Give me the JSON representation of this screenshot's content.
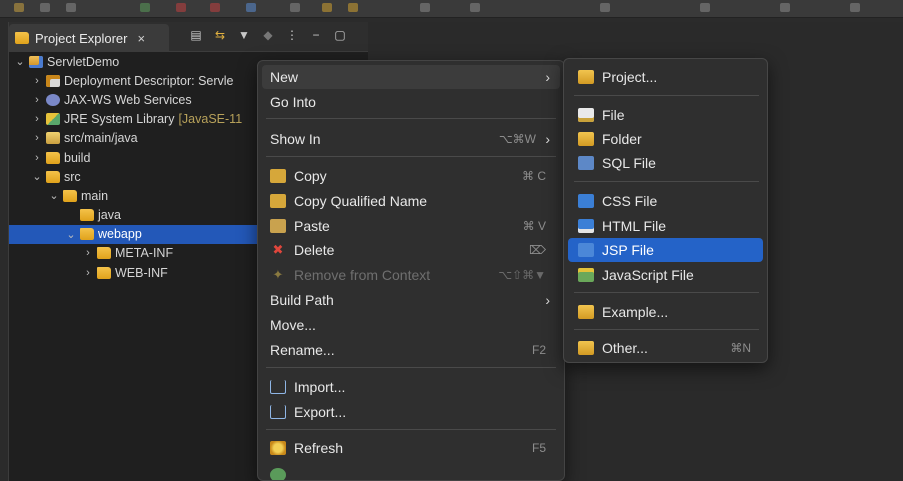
{
  "explorer": {
    "tab_title": "Project Explorer",
    "tab_close": "×",
    "tree": [
      {
        "indent": 0,
        "chev": "⌄",
        "icon": "project",
        "label": "ServletDemo"
      },
      {
        "indent": 1,
        "chev": "›",
        "icon": "descriptor",
        "label": "Deployment Descriptor: Servle"
      },
      {
        "indent": 1,
        "chev": "›",
        "icon": "webservices",
        "label": "JAX-WS Web Services"
      },
      {
        "indent": 1,
        "chev": "›",
        "icon": "library",
        "label": "JRE System Library",
        "extra": "[JavaSE-11"
      },
      {
        "indent": 1,
        "chev": "›",
        "icon": "package",
        "label": "src/main/java"
      },
      {
        "indent": 1,
        "chev": "›",
        "icon": "folder",
        "label": "build"
      },
      {
        "indent": 1,
        "chev": "⌄",
        "icon": "folder",
        "label": "src"
      },
      {
        "indent": 2,
        "chev": "⌄",
        "icon": "folder",
        "label": "main"
      },
      {
        "indent": 3,
        "chev": "",
        "icon": "folder",
        "label": "java"
      },
      {
        "indent": 3,
        "chev": "⌄",
        "icon": "folder",
        "label": "webapp",
        "selected": true
      },
      {
        "indent": 4,
        "chev": "›",
        "icon": "folder",
        "label": "META-INF"
      },
      {
        "indent": 4,
        "chev": "›",
        "icon": "folder",
        "label": "WEB-INF"
      }
    ]
  },
  "context_menu": {
    "new": "New",
    "go_into": "Go Into",
    "show_in": "Show In",
    "show_in_sc": "⌥⌘W",
    "copy": "Copy",
    "copy_sc": "⌘ C",
    "copy_qualified": "Copy Qualified Name",
    "paste": "Paste",
    "paste_sc": "⌘ V",
    "delete": "Delete",
    "delete_sc": "⌦",
    "remove_context": "Remove from Context",
    "remove_context_sc": "⌥⇧⌘▼",
    "build_path": "Build Path",
    "move": "Move...",
    "rename": "Rename...",
    "rename_sc": "F2",
    "import": "Import...",
    "export": "Export...",
    "refresh": "Refresh",
    "refresh_sc": "F5"
  },
  "submenu": {
    "project": "Project...",
    "file": "File",
    "folder": "Folder",
    "sql_file": "SQL File",
    "css_file": "CSS File",
    "html_file": "HTML File",
    "jsp_file": "JSP File",
    "javascript_file": "JavaScript File",
    "example": "Example...",
    "other": "Other...",
    "other_sc": "⌘N"
  },
  "colors": {
    "selection": "#2463c8",
    "menu_bg": "#2f2f2f",
    "panel_bg": "#1f1f1f"
  }
}
